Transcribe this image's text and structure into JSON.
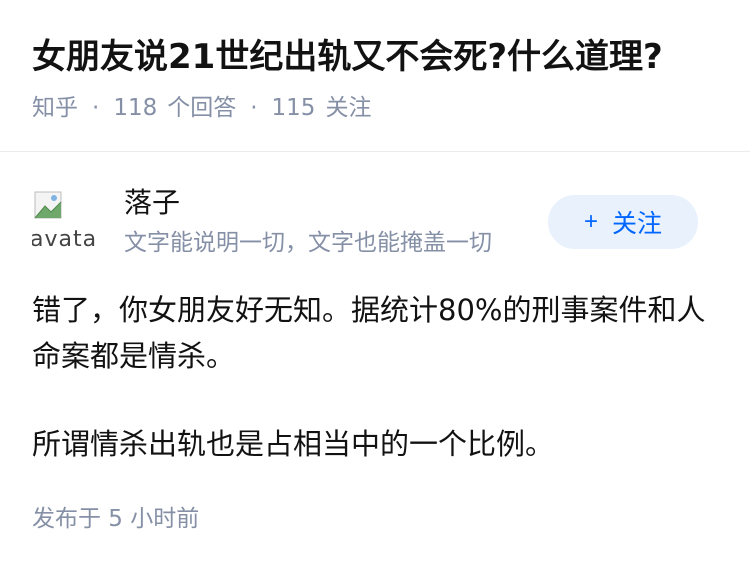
{
  "question": {
    "title": "女朋友说21世纪出轨又不会死?什么道理?",
    "site": "知乎",
    "answer_count": "118",
    "answer_label": "个回答",
    "follow_count": "115",
    "follow_label": "关注",
    "separator": "·"
  },
  "author": {
    "avatar_alt": "avatar",
    "name": "落子",
    "bio": "文字能说明一切，文字也能掩盖一切",
    "follow_button": {
      "icon": "plus-icon",
      "icon_glyph": "+",
      "label": "关注"
    }
  },
  "answer": {
    "paragraphs": [
      "错了，你女朋友好无知。据统计80%的刑事案件和人命案都是情杀。",
      "所谓情杀出轨也是占相当中的一个比例。"
    ],
    "published": "发布于 5 小时前"
  },
  "colors": {
    "accent": "#0066ff",
    "follow_bg": "#e8f1fc",
    "meta_text": "#8590a6"
  }
}
